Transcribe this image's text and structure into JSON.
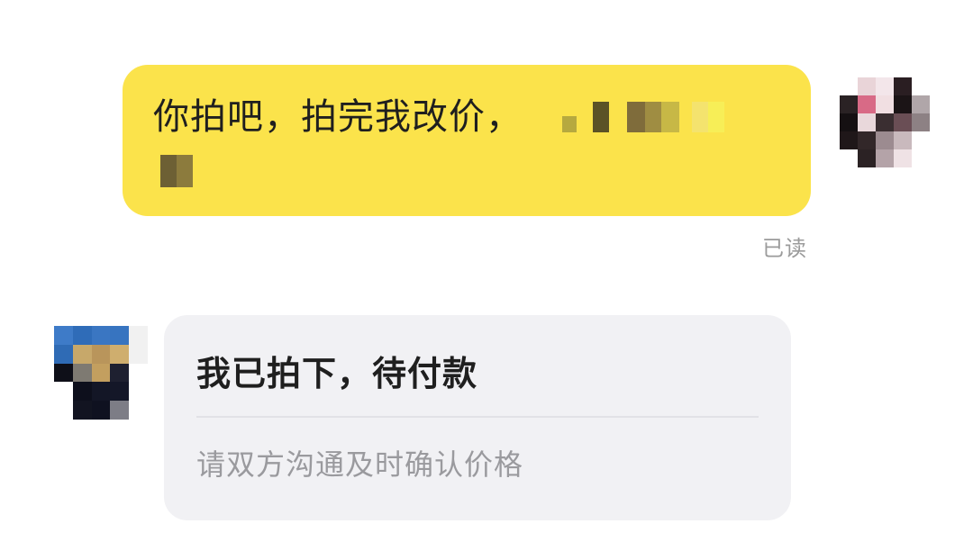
{
  "outgoing_message": {
    "text": "你拍吧，拍完我改价，",
    "bubble_color": "#fbe34b",
    "read_status": "已读"
  },
  "incoming_card": {
    "title": "我已拍下，待付款",
    "subtitle": "请双方沟通及时确认价格",
    "bubble_color": "#f1f1f4"
  },
  "avatars": {
    "self": "pixelated-avatar",
    "other": "pixelated-avatar"
  }
}
